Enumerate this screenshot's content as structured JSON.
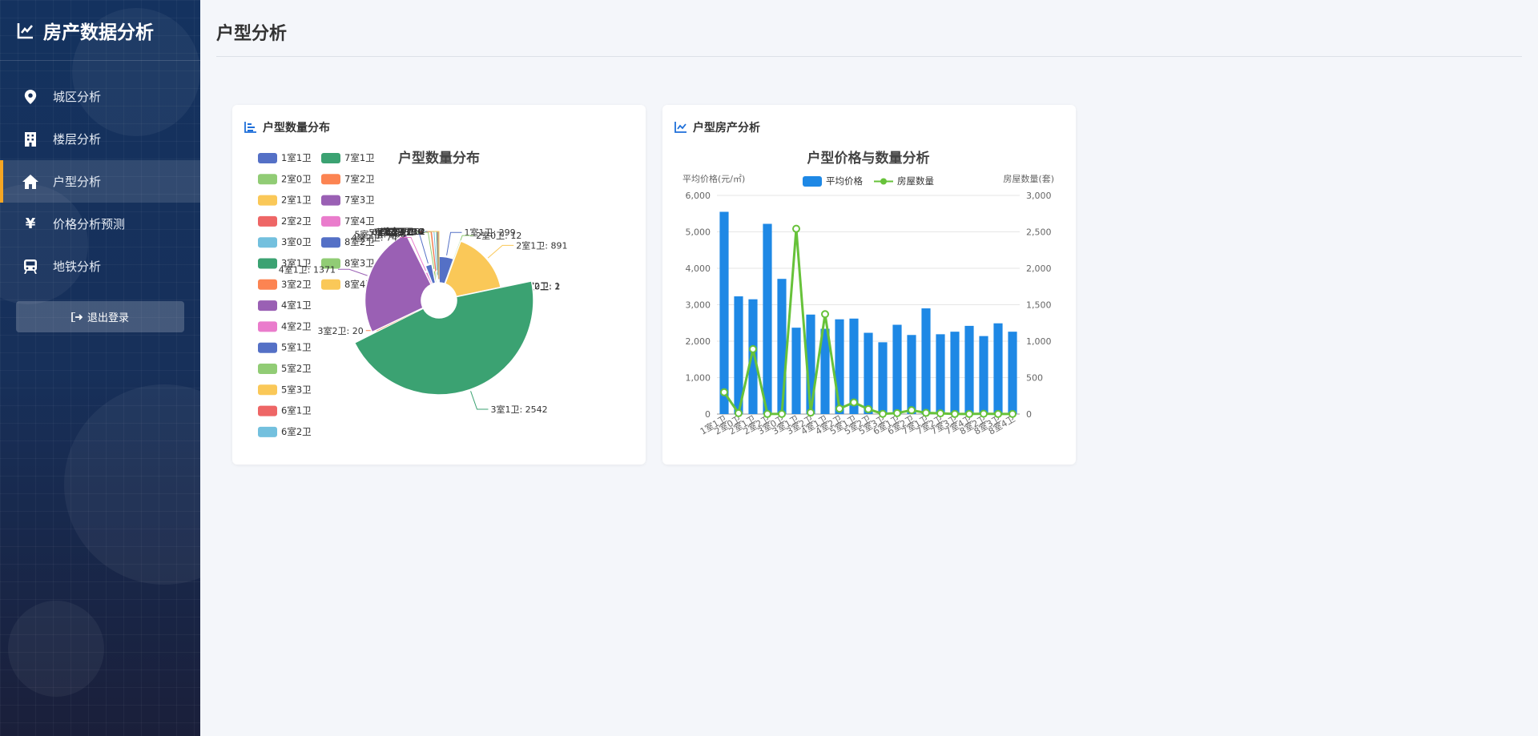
{
  "sidebar": {
    "brand": "房产数据分析",
    "items": [
      {
        "label": "城区分析",
        "icon": "map-pin-icon"
      },
      {
        "label": "楼层分析",
        "icon": "building-icon"
      },
      {
        "label": "户型分析",
        "icon": "home-icon",
        "active": true
      },
      {
        "label": "价格分析预测",
        "icon": "yen-icon"
      },
      {
        "label": "地铁分析",
        "icon": "subway-icon"
      }
    ],
    "logout": "退出登录"
  },
  "page": {
    "title": "户型分析"
  },
  "cards": {
    "pie_header": "户型数量分布",
    "bar_header": "户型房产分析"
  },
  "chart_data": [
    {
      "type": "pie",
      "variant": "rose",
      "title": "户型数量分布",
      "legend_position": "top-left",
      "slices": [
        {
          "name": "1室1卫",
          "value": 299,
          "color": "#5470c6"
        },
        {
          "name": "2室0卫",
          "value": 12,
          "color": "#91cc75"
        },
        {
          "name": "2室1卫",
          "value": 891,
          "color": "#fac858"
        },
        {
          "name": "2室2卫",
          "value": 1,
          "color": "#ee6666"
        },
        {
          "name": "3室0卫",
          "value": 2,
          "color": "#73c0de"
        },
        {
          "name": "3室1卫",
          "value": 2542,
          "color": "#3ba272"
        },
        {
          "name": "3室2卫",
          "value": 20,
          "color": "#fc8452"
        },
        {
          "name": "4室1卫",
          "value": 1371,
          "color": "#9a60b4"
        },
        {
          "name": "4室2卫",
          "value": 74,
          "color": "#ea7ccc"
        },
        {
          "name": "5室1卫",
          "value": 160,
          "color": "#5470c6"
        },
        {
          "name": "5室2卫",
          "value": 67,
          "color": "#91cc75"
        },
        {
          "name": "5室3卫",
          "value": 3,
          "color": "#fac858"
        },
        {
          "name": "6室1卫",
          "value": 13,
          "color": "#ee6666"
        },
        {
          "name": "6室2卫",
          "value": 53,
          "color": "#73c0de"
        },
        {
          "name": "7室1卫",
          "value": 16,
          "color": "#3ba272"
        },
        {
          "name": "7室2卫",
          "value": 10,
          "color": "#fc8452"
        },
        {
          "name": "7室3卫",
          "value": 1,
          "color": "#9a60b4"
        },
        {
          "name": "7室4卫",
          "value": 2,
          "color": "#ea7ccc"
        },
        {
          "name": "8室2卫",
          "value": 4,
          "color": "#5470c6"
        },
        {
          "name": "8室3卫",
          "value": 2,
          "color": "#91cc75"
        },
        {
          "name": "8室4卫",
          "value": 2,
          "color": "#fac858"
        }
      ]
    },
    {
      "type": "bar",
      "title": "户型价格与数量分析",
      "ylabel": "平均价格(元/㎡)",
      "y2label": "房屋数量(套)",
      "ylim": [
        0,
        6000
      ],
      "y2lim": [
        0,
        3000
      ],
      "yticks": [
        0,
        1000,
        2000,
        3000,
        4000,
        5000,
        6000
      ],
      "y2ticks": [
        0,
        500,
        1000,
        1500,
        2000,
        2500,
        3000
      ],
      "grid": true,
      "legend_position": "top-center",
      "categories": [
        "1室1卫",
        "2室0卫",
        "2室1卫",
        "2室2卫",
        "3室0卫",
        "3室1卫",
        "3室2卫",
        "4室1卫",
        "4室2卫",
        "5室1卫",
        "5室2卫",
        "5室3卫",
        "6室1卫",
        "6室2卫",
        "7室1卫",
        "7室2卫",
        "7室3卫",
        "7室4卫",
        "8室2卫",
        "8室3卫",
        "8室4卫"
      ],
      "series": [
        {
          "name": "平均价格",
          "kind": "bar",
          "axis": "left",
          "color": "#1e88e5",
          "values": [
            5550,
            3230,
            3150,
            5220,
            3710,
            2370,
            2730,
            2340,
            2600,
            2620,
            2230,
            1970,
            2450,
            2170,
            2900,
            2190,
            2260,
            2420,
            2140,
            2490,
            2260
          ]
        },
        {
          "name": "房屋数量",
          "kind": "line",
          "axis": "right",
          "color": "#67c23a",
          "values": [
            299,
            12,
            891,
            1,
            2,
            2542,
            20,
            1371,
            74,
            160,
            67,
            3,
            13,
            53,
            16,
            10,
            1,
            2,
            4,
            2,
            2
          ]
        }
      ]
    }
  ]
}
